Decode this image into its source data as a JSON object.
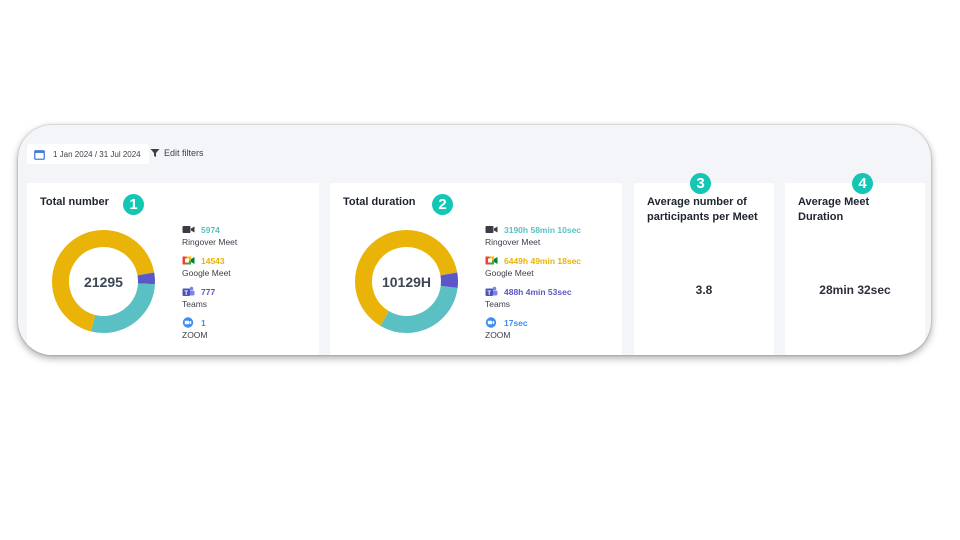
{
  "toolbar": {
    "date_range": "1 Jan 2024 / 31 Jul 2024",
    "edit_filters_label": "Edit filters"
  },
  "colors": {
    "ringover": "#5bc0c3",
    "google": "#eab308",
    "teams": "#5b57c9",
    "zoom": "#3d8df5",
    "badge": "#13c7b4"
  },
  "cards": {
    "total_number": {
      "title": "Total number",
      "badge": "1",
      "center_value": "21295",
      "legend": [
        {
          "icon": "ringover-icon",
          "value": "5974",
          "label": "Ringover Meet"
        },
        {
          "icon": "google-meet-icon",
          "value": "14543",
          "label": "Google Meet"
        },
        {
          "icon": "teams-icon",
          "value": "777",
          "label": "Teams"
        },
        {
          "icon": "zoom-icon",
          "value": "1",
          "label": "ZOOM"
        }
      ]
    },
    "total_duration": {
      "title": "Total duration",
      "badge": "2",
      "center_value": "10129H",
      "legend": [
        {
          "icon": "ringover-icon",
          "value": "3190h 58min 10sec",
          "label": "Ringover Meet"
        },
        {
          "icon": "google-meet-icon",
          "value": "6449h 49min 18sec",
          "label": "Google Meet"
        },
        {
          "icon": "teams-icon",
          "value": "488h 4min 53sec",
          "label": "Teams"
        },
        {
          "icon": "zoom-icon",
          "value": "17sec",
          "label": "ZOOM"
        }
      ]
    },
    "avg_participants": {
      "title_line1": "Average number of",
      "title_line2": "participants per Meet",
      "badge": "3",
      "value": "3.8"
    },
    "avg_duration": {
      "title_line1": "Average Meet",
      "title_line2": "Duration",
      "badge": "4",
      "value": "28min 32sec"
    }
  },
  "chart_data": [
    {
      "type": "pie",
      "title": "Total number",
      "categories": [
        "Ringover Meet",
        "Google Meet",
        "Teams",
        "ZOOM"
      ],
      "values": [
        5974,
        14543,
        777,
        1
      ],
      "colors": [
        "#5bc0c3",
        "#eab308",
        "#5b57c9",
        "#3d8df5"
      ]
    },
    {
      "type": "pie",
      "title": "Total duration",
      "categories": [
        "Ringover Meet",
        "Google Meet",
        "Teams",
        "ZOOM"
      ],
      "values": [
        3190.97,
        6449.82,
        488.08,
        0.005
      ],
      "colors": [
        "#5bc0c3",
        "#eab308",
        "#5b57c9",
        "#3d8df5"
      ]
    }
  ]
}
